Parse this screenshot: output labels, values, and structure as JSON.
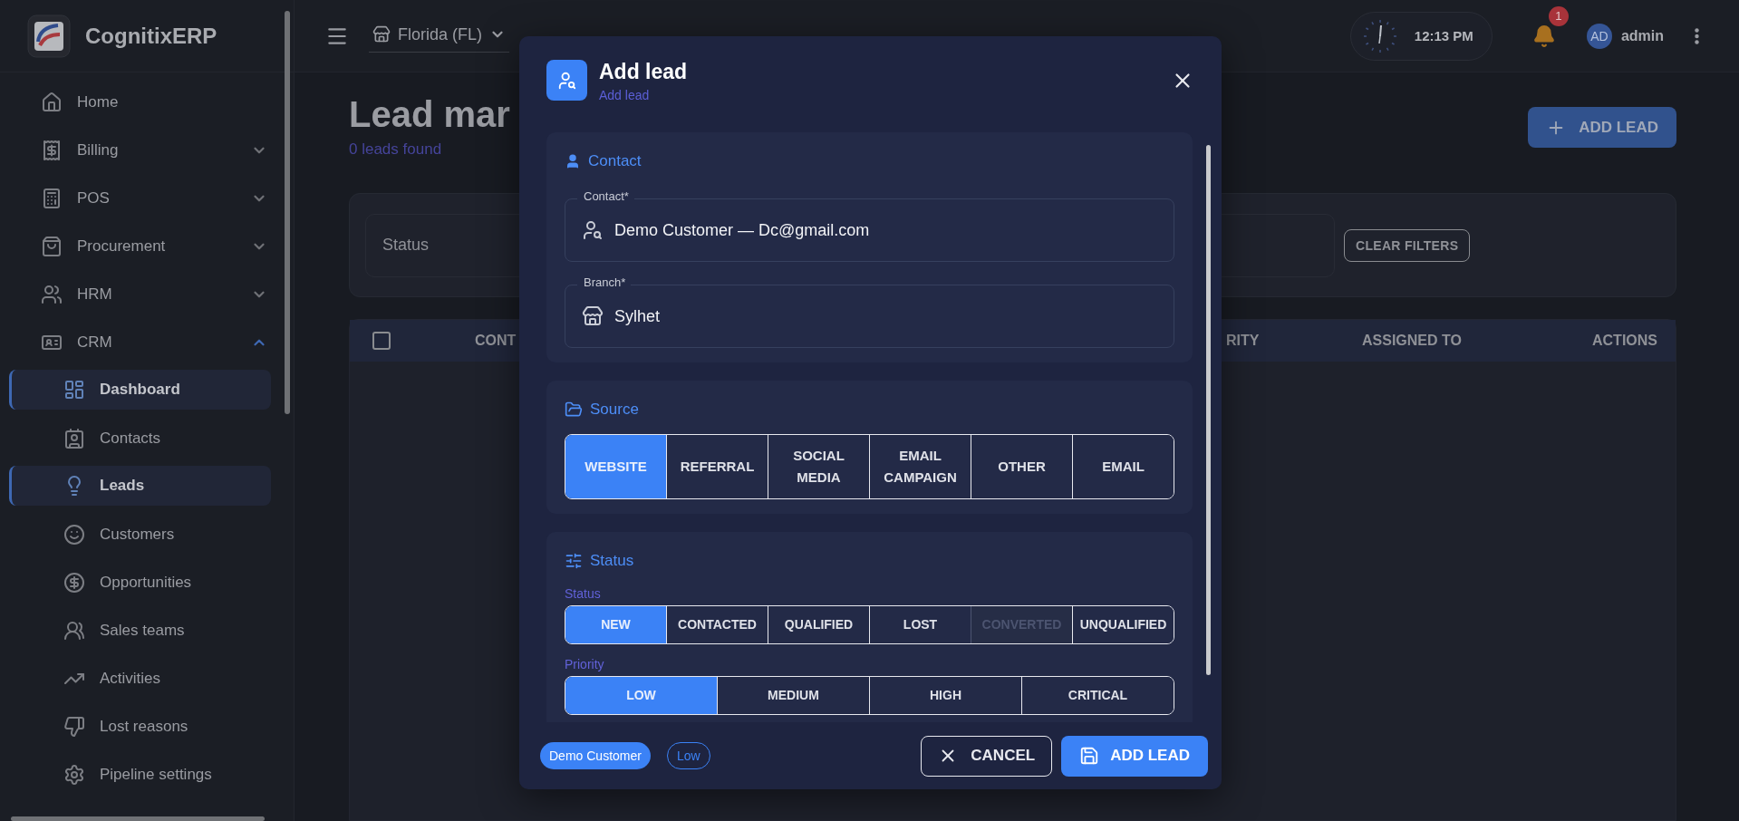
{
  "sidebar": {
    "brand": "CognitixERP",
    "items": [
      {
        "label": "Home"
      },
      {
        "label": "Billing",
        "expanded": false
      },
      {
        "label": "POS",
        "expanded": false
      },
      {
        "label": "Procurement",
        "expanded": false
      },
      {
        "label": "HRM",
        "expanded": false
      },
      {
        "label": "CRM",
        "expanded": true,
        "children": [
          {
            "label": "Dashboard",
            "selected": true
          },
          {
            "label": "Contacts",
            "selected": false
          },
          {
            "label": "Leads",
            "selected": true
          },
          {
            "label": "Customers",
            "selected": false
          },
          {
            "label": "Opportunities",
            "selected": false
          },
          {
            "label": "Sales teams",
            "selected": false
          },
          {
            "label": "Activities",
            "selected": false
          },
          {
            "label": "Lost reasons",
            "selected": false
          },
          {
            "label": "Pipeline settings",
            "selected": false
          }
        ]
      }
    ]
  },
  "topbar": {
    "branch": "Florida (FL)",
    "time": "12:13 PM",
    "notifications": "1",
    "avatar": "AD",
    "user": "admin"
  },
  "page": {
    "title": "Lead mar",
    "count": "0 leads found",
    "add_button": "ADD LEAD",
    "filters": {
      "field": "Status",
      "clear_button": "CLEAR FILTERS"
    },
    "table": {
      "select_all_checked": false,
      "columns": [
        "CONT",
        "RITY",
        "ASSIGNED TO",
        "ACTIONS"
      ]
    }
  },
  "modal": {
    "title": "Add lead",
    "subtitle": "Add lead",
    "contact": {
      "heading": "Contact",
      "fields": [
        {
          "label": "Contact*",
          "value": "Demo Customer — Dc@gmail.com"
        },
        {
          "label": "Branch*",
          "value": "Sylhet"
        }
      ]
    },
    "source": {
      "heading": "Source",
      "options": [
        {
          "label": "WEBSITE",
          "selected": true
        },
        {
          "label": "REFERRAL",
          "selected": false
        },
        {
          "label": "SOCIAL MEDIA",
          "selected": false
        },
        {
          "label": "EMAIL CAMPAIGN",
          "selected": false
        },
        {
          "label": "OTHER",
          "selected": false
        },
        {
          "label": "EMAIL",
          "selected": false
        }
      ]
    },
    "status": {
      "heading": "Status",
      "groups": [
        {
          "label": "Status",
          "options": [
            {
              "label": "NEW",
              "selected": true,
              "disabled": false
            },
            {
              "label": "CONTACTED",
              "selected": false,
              "disabled": false
            },
            {
              "label": "QUALIFIED",
              "selected": false,
              "disabled": false
            },
            {
              "label": "LOST",
              "selected": false,
              "disabled": false
            },
            {
              "label": "CONVERTED",
              "selected": false,
              "disabled": true
            },
            {
              "label": "UNQUALIFIED",
              "selected": false,
              "disabled": false
            }
          ]
        },
        {
          "label": "Priority",
          "options": [
            {
              "label": "LOW",
              "selected": true,
              "disabled": false
            },
            {
              "label": "MEDIUM",
              "selected": false,
              "disabled": false
            },
            {
              "label": "HIGH",
              "selected": false,
              "disabled": false
            },
            {
              "label": "CRITICAL",
              "selected": false,
              "disabled": false
            }
          ]
        }
      ]
    },
    "footer": {
      "chips": [
        {
          "label": "Demo Customer",
          "kind": "filled"
        },
        {
          "label": "Low",
          "kind": "outlined"
        }
      ],
      "cancel": "CANCEL",
      "submit": "ADD LEAD"
    }
  }
}
